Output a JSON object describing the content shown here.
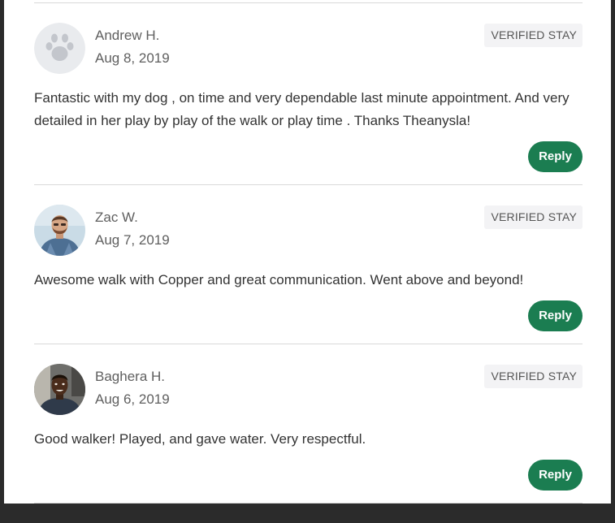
{
  "reviews": [
    {
      "name": "Andrew H.",
      "date": "Aug 8, 2019",
      "badge": "VERIFIED STAY",
      "text": "Fantastic with my dog , on time and very dependable last minute appointment. And very detailed in her play by play of the walk or play time . Thanks Theanysla!",
      "reply_label": "Reply",
      "avatar_icon": "paw-icon"
    },
    {
      "name": "Zac W.",
      "date": "Aug 7, 2019",
      "badge": "VERIFIED STAY",
      "text": "Awesome walk with Copper and great communication. Went above and beyond!",
      "reply_label": "Reply",
      "avatar_icon": "user-photo"
    },
    {
      "name": "Baghera H.",
      "date": "Aug 6, 2019",
      "badge": "VERIFIED STAY",
      "text": "Good walker! Played, and gave water. Very respectful.",
      "reply_label": "Reply",
      "avatar_icon": "user-photo"
    }
  ],
  "colors": {
    "reply_button": "#1b7d51",
    "badge_bg": "#f3f3f5",
    "divider": "#d9d9d9"
  }
}
